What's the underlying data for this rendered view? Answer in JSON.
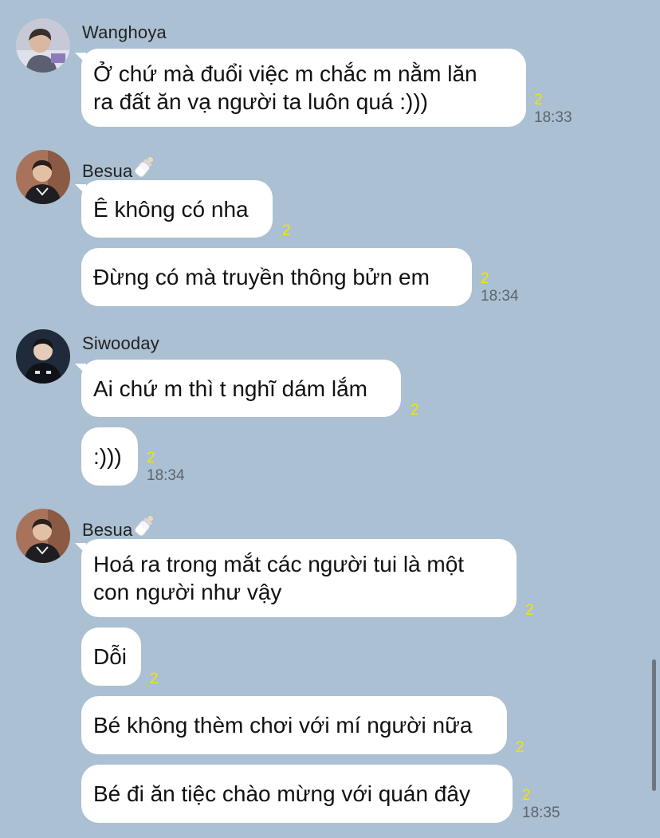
{
  "chat": {
    "groups": [
      {
        "sender": "Wanghoya",
        "messages": [
          {
            "lines": [
              "Ở chứ mà đuổi việc m chắc m nằm lăn",
              "ra đất ăn vạ người ta luôn quá :)))"
            ],
            "read": "2",
            "time": "18:33"
          }
        ]
      },
      {
        "sender": "Besua",
        "messages": [
          {
            "lines": [
              "Ê không có nha"
            ],
            "read": "2"
          },
          {
            "lines": [
              "Đừng có mà truyền thông bửn em"
            ],
            "read": "2",
            "time": "18:34"
          }
        ]
      },
      {
        "sender": "Siwooday",
        "messages": [
          {
            "lines": [
              "Ai chứ m thì t nghĩ dám lắm"
            ],
            "read": "2"
          },
          {
            "lines": [
              ":)))"
            ],
            "read": "2",
            "time": "18:34"
          }
        ]
      },
      {
        "sender": "Besua",
        "messages": [
          {
            "lines": [
              "Hoá ra trong mắt các người tui là một",
              "con người như vậy"
            ],
            "read": "2"
          },
          {
            "lines": [
              "Dỗi"
            ],
            "read": "2"
          },
          {
            "lines": [
              "Bé không thèm chơi với mí người nữa"
            ],
            "read": "2"
          },
          {
            "lines": [
              "Bé đi ăn tiệc chào mừng với quán đây"
            ],
            "read": "2",
            "time": "18:35"
          }
        ]
      }
    ]
  },
  "icons": {
    "sender_badge": "baby-bottle-icon"
  },
  "colors": {
    "background": "#abc0d2",
    "bubble": "#ffffff",
    "read_count": "#f2e400",
    "timestamp": "#5c6570"
  }
}
